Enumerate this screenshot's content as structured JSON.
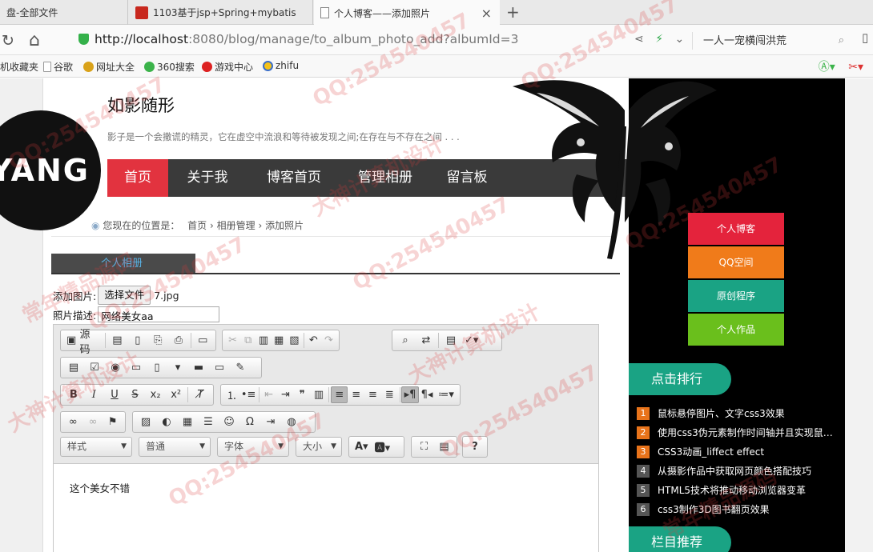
{
  "browser": {
    "tabs": [
      {
        "label": "盘-全部文件"
      },
      {
        "label": "1103基于jsp+Spring+mybatis"
      },
      {
        "label": "个人博客——添加照片"
      }
    ],
    "url_host": "http://localhost",
    "url_path": ":8080/blog/manage/to_album_photo_add?albumId=3",
    "search_text": "一人一宠横闯洪荒",
    "bookmarks": [
      "机收藏夹",
      "谷歌",
      "网址大全",
      "360搜索",
      "游戏中心",
      "zhifu"
    ]
  },
  "site": {
    "title": "如影随形",
    "description": "影子是一个会撒谎的精灵，它在虚空中流浪和等待被发现之间;在存在与不存在之间 . . .",
    "logo_text": "YANG"
  },
  "nav": {
    "items": [
      "首页",
      "关于我",
      "博客首页",
      "管理相册",
      "留言板"
    ],
    "active": 0
  },
  "breadcrumb": {
    "prefix": "您现在的位置是：",
    "items": [
      "首页",
      "相册管理",
      "添加照片"
    ]
  },
  "section": {
    "title": "个人相册"
  },
  "form": {
    "file_label": "添加图片:",
    "file_button": "选择文件",
    "file_name": "7.jpg",
    "desc_label": "照片描述:",
    "desc_value": "网络美女aa"
  },
  "editor": {
    "source_label": "源码",
    "style_combo": "样式",
    "format_combo": "普通",
    "font_combo": "字体",
    "size_combo": "大小",
    "content": "这个美女不错"
  },
  "sidebar": {
    "buttons": [
      {
        "label": "个人博客",
        "color": "#e4233c"
      },
      {
        "label": "QQ空间",
        "color": "#f07b1a"
      },
      {
        "label": "原创程序",
        "color": "#1aa384"
      },
      {
        "label": "个人作品",
        "color": "#6abf1c"
      }
    ],
    "rank_title": "点击排行",
    "rank_items": [
      {
        "n": "1",
        "text": "鼠标悬停图片、文字css3效果",
        "color": "#e8731a"
      },
      {
        "n": "2",
        "text": "使用css3伪元素制作时间轴并且实现鼠…",
        "color": "#e8731a"
      },
      {
        "n": "3",
        "text": "CSS3动画_liffect effect",
        "color": "#e8731a"
      },
      {
        "n": "4",
        "text": "从摄影作品中获取网页颜色搭配技巧",
        "color": "#555555"
      },
      {
        "n": "5",
        "text": "HTML5技术将推动移动浏览器变革",
        "color": "#555555"
      },
      {
        "n": "6",
        "text": "css3制作3D图书翻页效果",
        "color": "#555555"
      }
    ],
    "recommend_title": "栏目推荐"
  },
  "watermarks": [
    "QQ:254540457",
    "大神计算机设计",
    "常年精品源码"
  ]
}
